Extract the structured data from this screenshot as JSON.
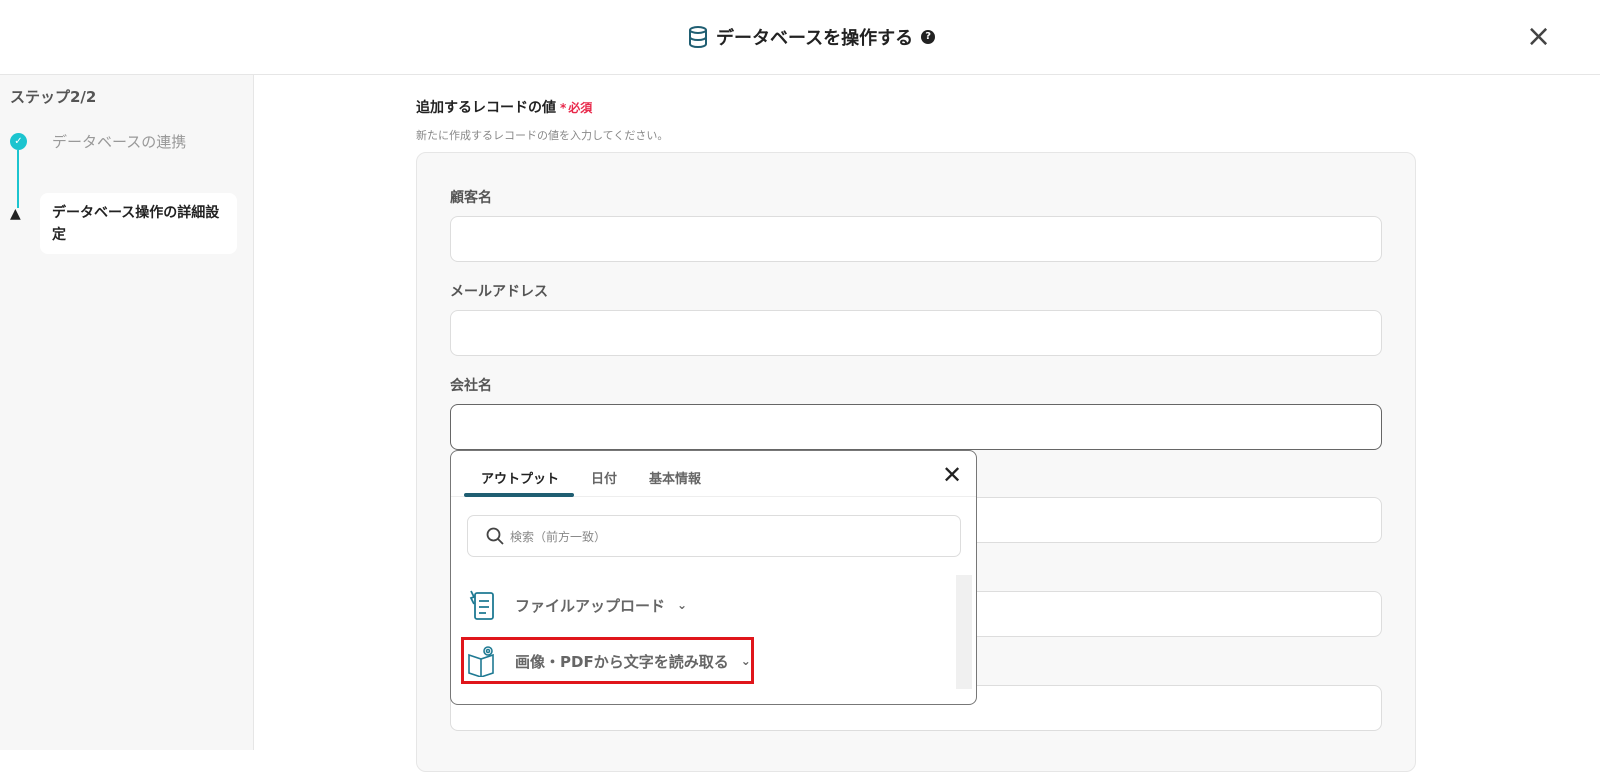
{
  "header": {
    "title": "データベースを操作する",
    "help": "?",
    "close": "×"
  },
  "sidebar": {
    "step": "ステップ2/2",
    "items": [
      {
        "label": "データベースの連携",
        "status": "done"
      },
      {
        "label": "データベース操作の詳細設定",
        "status": "warning"
      }
    ]
  },
  "section": {
    "title": "追加するレコードの値",
    "required_mark": "*",
    "required": "必須",
    "description": "新たに作成するレコードの値を入力してください。"
  },
  "fields": [
    {
      "label": "顧客名",
      "value": ""
    },
    {
      "label": "メールアドレス",
      "value": ""
    },
    {
      "label": "会社名",
      "value": ""
    },
    {
      "value": ""
    },
    {
      "value": ""
    },
    {
      "value": ""
    }
  ],
  "popup": {
    "tabs": [
      "アウトプット",
      "日付",
      "基本情報"
    ],
    "active_tab": 0,
    "search_placeholder": "検索（前方一致）",
    "items": [
      {
        "label": "ファイルアップロード"
      },
      {
        "label": "画像・PDFから文字を読み取る"
      }
    ]
  }
}
